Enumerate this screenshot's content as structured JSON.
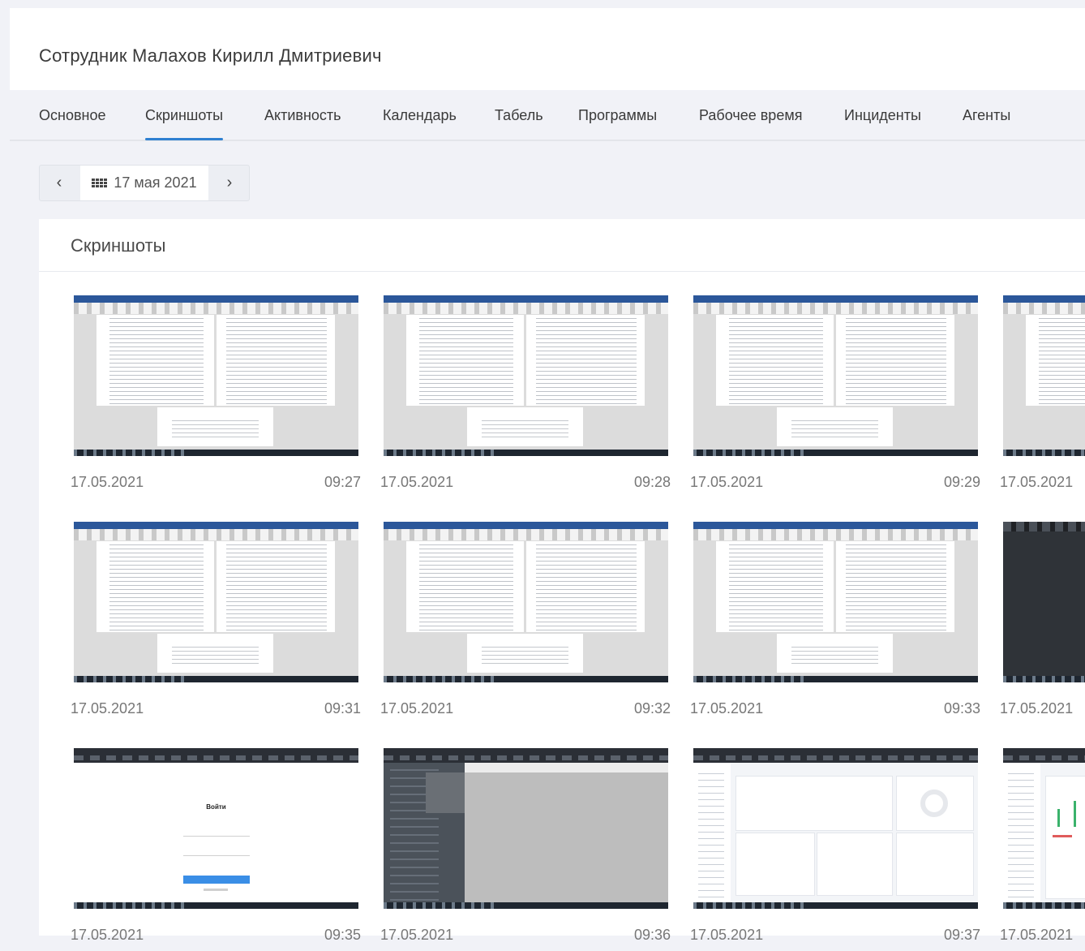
{
  "header": {
    "title": "Сотрудник Малахов Кирилл Дмитриевич"
  },
  "tabs": [
    {
      "label": "Основное",
      "active": false
    },
    {
      "label": "Скриншоты",
      "active": true
    },
    {
      "label": "Активность",
      "active": false
    },
    {
      "label": "Календарь",
      "active": false
    },
    {
      "label": "Табель",
      "active": false
    },
    {
      "label": "Программы",
      "active": false
    },
    {
      "label": "Рабочее время",
      "active": false
    },
    {
      "label": "Инциденты",
      "active": false
    },
    {
      "label": "Агенты",
      "active": false
    }
  ],
  "datepicker": {
    "prev_icon": "‹",
    "next_icon": "›",
    "icon": "calendar-icon",
    "value": "17 мая 2021"
  },
  "panel": {
    "title": "Скриншоты"
  },
  "screenshots": [
    {
      "date": "17.05.2021",
      "time": "09:27",
      "kind": "document"
    },
    {
      "date": "17.05.2021",
      "time": "09:28",
      "kind": "document"
    },
    {
      "date": "17.05.2021",
      "time": "09:29",
      "kind": "document"
    },
    {
      "date": "17.05.2021",
      "time": "",
      "kind": "document"
    },
    {
      "date": "17.05.2021",
      "time": "09:31",
      "kind": "document"
    },
    {
      "date": "17.05.2021",
      "time": "09:32",
      "kind": "document"
    },
    {
      "date": "17.05.2021",
      "time": "09:33",
      "kind": "document"
    },
    {
      "date": "17.05.2021",
      "time": "",
      "kind": "dark"
    },
    {
      "date": "17.05.2021",
      "time": "09:35",
      "kind": "login"
    },
    {
      "date": "17.05.2021",
      "time": "09:36",
      "kind": "app"
    },
    {
      "date": "17.05.2021",
      "time": "09:37",
      "kind": "dashboard"
    },
    {
      "date": "17.05.2021",
      "time": "",
      "kind": "dashboard"
    }
  ],
  "login_thumb": {
    "title": "Войти"
  },
  "colors": {
    "accent": "#2f80d1",
    "word_blue": "#2b579a"
  }
}
